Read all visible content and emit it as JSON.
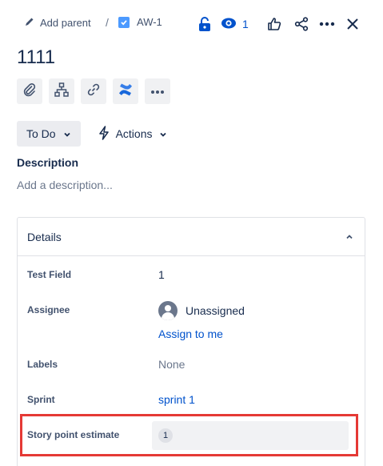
{
  "topbar": {
    "add_parent_label": "Add parent",
    "separator": "/",
    "issue_key": "AW-1",
    "watch_count": "1",
    "icons": [
      "pencil-icon",
      "checkbox-icon",
      "unlock-icon",
      "eye-icon",
      "thumbs-up-icon",
      "share-icon",
      "more-icon",
      "close-icon"
    ]
  },
  "issue": {
    "title": "1111"
  },
  "quick_actions": [
    "paperclip-icon",
    "child-issues-icon",
    "link-icon",
    "confluence-icon",
    "more-icon"
  ],
  "status": {
    "label": "To Do",
    "actions_label": "Actions"
  },
  "description": {
    "label": "Description",
    "placeholder": "Add a description..."
  },
  "details": {
    "title": "Details",
    "fields": {
      "test_field": {
        "label": "Test Field",
        "value": "1"
      },
      "assignee": {
        "label": "Assignee",
        "value": "Unassigned",
        "action": "Assign to me"
      },
      "labels": {
        "label": "Labels",
        "value": "None"
      },
      "sprint": {
        "label": "Sprint",
        "value": "sprint 1"
      },
      "story_points": {
        "label": "Story point estimate",
        "value": "1"
      }
    }
  },
  "colors": {
    "link": "#0052cc",
    "highlight": "#e53935",
    "text": "#172b4d"
  }
}
